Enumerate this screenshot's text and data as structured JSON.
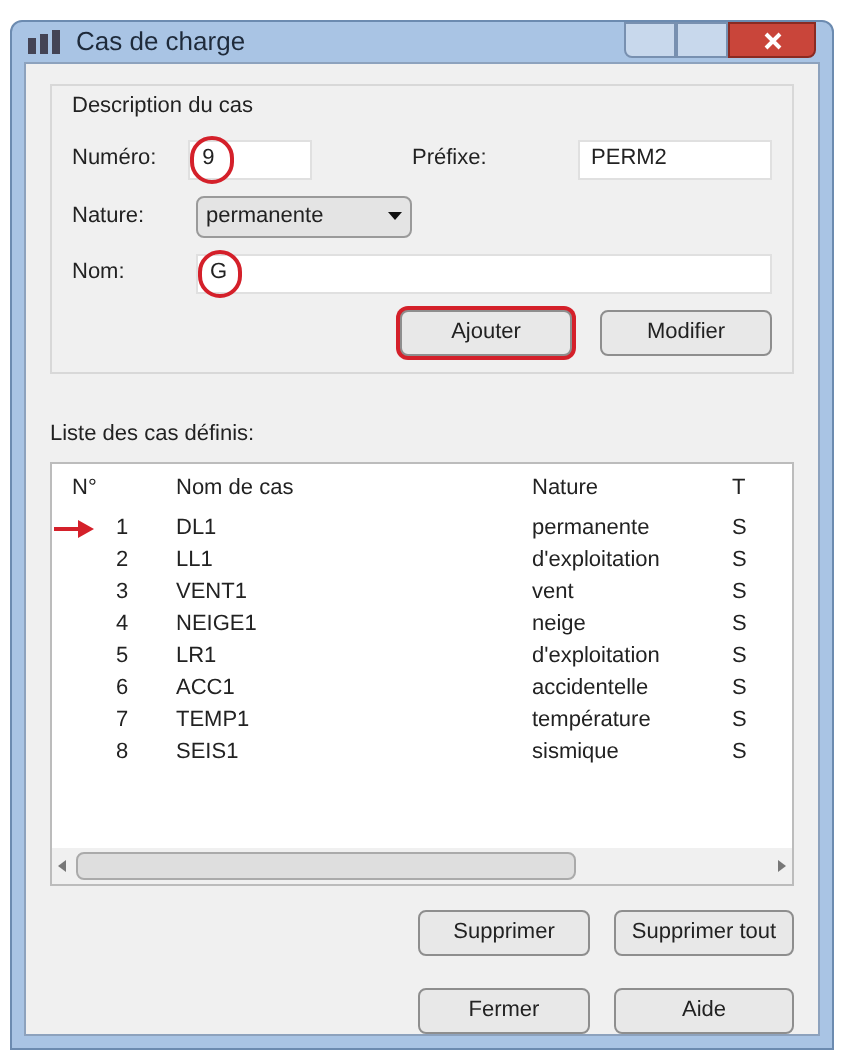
{
  "window": {
    "title": "Cas de charge"
  },
  "description": {
    "title": "Description du cas",
    "numero": {
      "label": "Numéro:",
      "value": "9",
      "circled": true
    },
    "prefixe": {
      "label": "Préfixe:",
      "value": "PERM2"
    },
    "nature": {
      "label": "Nature:",
      "value": "permanente"
    },
    "nom": {
      "label": "Nom:",
      "value": "G",
      "circled": true
    },
    "buttons": [
      {
        "label": "Ajouter",
        "circled": true
      },
      {
        "label": "Modifier",
        "circled": false
      }
    ]
  },
  "list": {
    "title": "Liste des cas définis:",
    "columns": [
      "N°",
      "Nom de cas",
      "Nature",
      "T"
    ],
    "rows": [
      {
        "cells": [
          "1",
          "DL1",
          "permanente",
          "S"
        ],
        "arrow": true
      },
      {
        "cells": [
          "2",
          "LL1",
          "d'exploitation",
          "S"
        ],
        "arrow": false
      },
      {
        "cells": [
          "3",
          "VENT1",
          "vent",
          "S"
        ],
        "arrow": false
      },
      {
        "cells": [
          "4",
          "NEIGE1",
          "neige",
          "S"
        ],
        "arrow": false
      },
      {
        "cells": [
          "5",
          "LR1",
          "d'exploitation",
          "S"
        ],
        "arrow": false
      },
      {
        "cells": [
          "6",
          "ACC1",
          "accidentelle",
          "S"
        ],
        "arrow": false
      },
      {
        "cells": [
          "7",
          "TEMP1",
          "température",
          "S"
        ],
        "arrow": false
      },
      {
        "cells": [
          "8",
          "SEIS1",
          "sismique",
          "S"
        ],
        "arrow": false
      }
    ]
  },
  "list_buttons": [
    "Supprimer",
    "Supprimer tout"
  ],
  "footer_buttons": [
    "Fermer",
    "Aide"
  ]
}
